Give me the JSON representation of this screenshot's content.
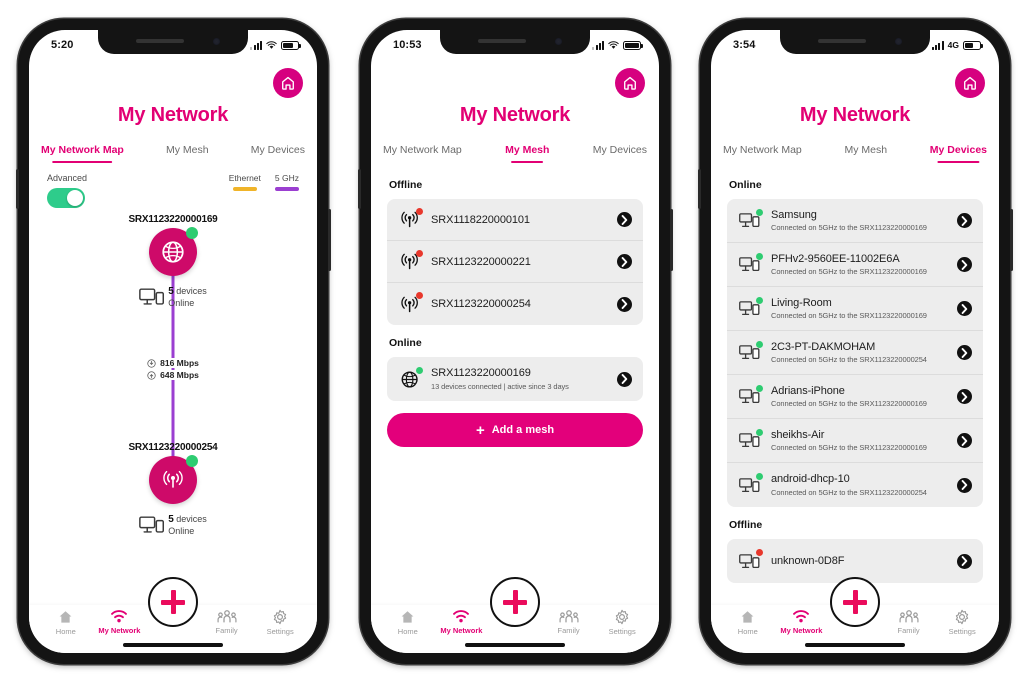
{
  "brand": {
    "magenta": "#E20074",
    "node_pink": "#CE0A69",
    "link_purple": "#9B3FD1",
    "ethernet_yellow": "#F0B429",
    "online_green": "#2ECC71",
    "offline_red": "#E8382C"
  },
  "app": {
    "title": "My Network",
    "home_icon": "house-icon",
    "fab_icon": "plus-icon"
  },
  "tabs": [
    {
      "label": "My Network Map",
      "name": "tab-my-network-map"
    },
    {
      "label": "My Mesh",
      "name": "tab-my-mesh"
    },
    {
      "label": "My Devices",
      "name": "tab-my-devices"
    }
  ],
  "bottom_nav": [
    {
      "label": "Home",
      "icon": "home-icon"
    },
    {
      "label": "My Network",
      "icon": "wifi-icon"
    },
    {
      "label": "Family",
      "icon": "family-icon"
    },
    {
      "label": "Settings",
      "icon": "gear-icon"
    }
  ],
  "phone1": {
    "status": {
      "time": "5:20",
      "network": "",
      "signal": "partial",
      "wifi": true,
      "battery": "70"
    },
    "active_tab": 0,
    "advanced": {
      "label": "Advanced",
      "enabled": true
    },
    "legend": [
      {
        "label": "Ethernet",
        "color": "#F0B429"
      },
      {
        "label": "5 GHz",
        "color": "#9B3FD1"
      }
    ],
    "map": {
      "top_node": {
        "name": "SRX1123220000169",
        "icon": "globe-icon",
        "status": "online",
        "device_count": "5",
        "device_label": "devices",
        "device_status": "Online"
      },
      "bottom_node": {
        "name": "SRX1123220000254",
        "icon": "antenna-icon",
        "status": "online",
        "device_count": "5",
        "device_label": "devices",
        "device_status": "Online"
      },
      "speeds": [
        {
          "icon": "download-icon",
          "value": "816 Mbps"
        },
        {
          "icon": "upload-icon",
          "value": "648 Mbps"
        }
      ]
    },
    "active_nav": 1
  },
  "phone2": {
    "status": {
      "time": "10:53",
      "network": "",
      "signal": "partial",
      "wifi": true,
      "battery": "100"
    },
    "active_tab": 1,
    "active_nav": 1,
    "sections": [
      {
        "label": "Offline",
        "items": [
          {
            "title": "SRX1118220000101",
            "sub": "",
            "icon": "antenna-icon",
            "status": "offline"
          },
          {
            "title": "SRX1123220000221",
            "sub": "",
            "icon": "antenna-icon",
            "status": "offline"
          },
          {
            "title": "SRX1123220000254",
            "sub": "",
            "icon": "antenna-icon",
            "status": "offline"
          }
        ]
      },
      {
        "label": "Online",
        "items": [
          {
            "title": "SRX1123220000169",
            "sub": "13 devices connected  |  active since 3 days",
            "icon": "globe-icon",
            "status": "online"
          }
        ]
      }
    ],
    "add_mesh_label": "Add a mesh"
  },
  "phone3": {
    "status": {
      "time": "3:54",
      "network": "4G",
      "signal": "full",
      "wifi": false,
      "battery": "60"
    },
    "active_tab": 2,
    "active_nav": 1,
    "sections": [
      {
        "label": "Online",
        "items": [
          {
            "title": "Samsung",
            "sub": "Connected on 5GHz to the SRX1123220000169",
            "icon": "monitor-icon",
            "status": "online"
          },
          {
            "title": "PFHv2-9560EE-11002E6A",
            "sub": "Connected on 5GHz to the SRX1123220000169",
            "icon": "monitor-icon",
            "status": "online"
          },
          {
            "title": "Living-Room",
            "sub": "Connected on 5GHz to the SRX1123220000169",
            "icon": "monitor-icon",
            "status": "online"
          },
          {
            "title": "2C3-PT-DAKMOHAM",
            "sub": "Connected on 5GHz to the SRX1123220000254",
            "icon": "monitor-icon",
            "status": "online"
          },
          {
            "title": "Adrians-iPhone",
            "sub": "Connected on 5GHz to the SRX1123220000169",
            "icon": "monitor-icon",
            "status": "online"
          },
          {
            "title": "sheikhs-Air",
            "sub": "Connected on 5GHz to the SRX1123220000169",
            "icon": "monitor-icon",
            "status": "online"
          },
          {
            "title": "android-dhcp-10",
            "sub": "Connected on 5GHz to the SRX1123220000254",
            "icon": "monitor-icon",
            "status": "online"
          }
        ]
      },
      {
        "label": "Offline",
        "items": [
          {
            "title": "unknown-0D8F",
            "sub": "",
            "icon": "monitor-icon",
            "status": "offline"
          }
        ]
      }
    ]
  }
}
